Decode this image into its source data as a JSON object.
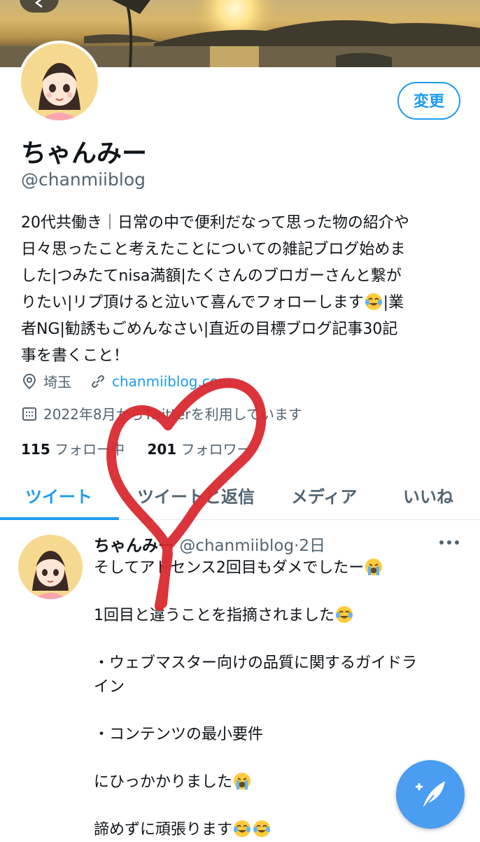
{
  "profile": {
    "display_name": "ちゃんみー",
    "handle": "@chanmiiblog",
    "edit_label": "変更",
    "bio_lines": [
      "20代共働き｜日常の中で便利だなって思った物の紹介や",
      "日々思ったこと考えたことについての雑記ブログ始めま",
      "した|つみたてnisa満額|たくさんのブロガーさんと繋が",
      "りたい|リプ頂けると泣いて喜んでフォローします",
      "者NG|勧誘もごめんなさい|直近の目標ブログ記事30記",
      "事を書くこと！"
    ],
    "bio_line4_tail": "|業",
    "location": "埼玉",
    "website": "chanmiiblog.com",
    "joined": "2022年8月からTwitterを利用しています",
    "following_count": "115",
    "following_label": "フォロー中",
    "followers_count": "201",
    "followers_label": "フォロワー"
  },
  "tabs": [
    "ツイート",
    "ツイートと返信",
    "メディア",
    "いいね"
  ],
  "tweet": {
    "author": "ちゃんみー",
    "handle": "@chanmiiblog",
    "time": "·2日",
    "lines": [
      "そしてアドセンス2回目もダメでしたー",
      "",
      "1回目と違うことを指摘されました",
      "",
      "・ウェブマスター向けの品質に関するガイドラ",
      "イン",
      "",
      "・コンテンツの最小要件",
      "",
      "にひっかかりました",
      "",
      "諦めずに頑張ります"
    ]
  },
  "icons": {
    "back": "arrow-left-icon",
    "location": "location-pin-icon",
    "link": "link-icon",
    "calendar": "calendar-icon",
    "more": "more-dots-icon",
    "compose": "compose-tweet-icon"
  },
  "colors": {
    "accent": "#1d9bf0",
    "secondary_text": "#536471",
    "heart_annotation": "#d9292f"
  }
}
